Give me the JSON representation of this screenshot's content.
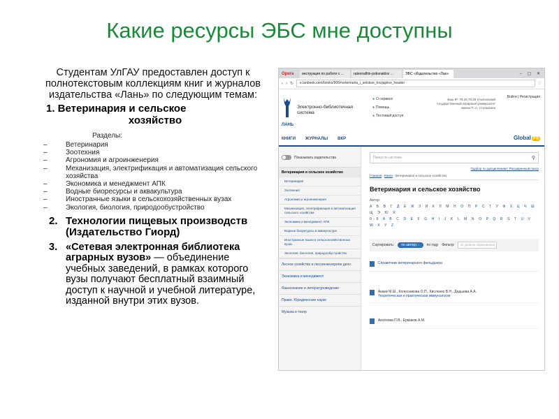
{
  "slide": {
    "title": "Какие ресурсы ЭБС мне доступны",
    "intro": "Студентам УлГАУ предоставлен доступ к полнотекстовым коллекциям книг и журналов издательства «Лань» по следующим темам:",
    "item1": {
      "line1": "1. Ветеринария и сельское",
      "line2": "хозяйство"
    },
    "sections_label": "Разделы:",
    "sections": [
      "Ветеринария",
      "Зоотехния",
      "Агрономия и агроинженерия",
      "Механизация, электрификация и автоматизация сельского хозяйства",
      "Экономика и менеджмент АПК",
      "Водные биоресурсы и аквакультура",
      "Иностранные языки в сельскохозяйственных вузах",
      "Экология, биология, природообустройство"
    ],
    "item2": {
      "lead": "2.",
      "body": "Технологии пищевых производств (Издательство Гиорд)"
    },
    "item3": {
      "lead": "3.",
      "body_bold": "«Сетевая электронная библиотека аграрных вузов»",
      "body_rest": " — объединение учебных заведений, в рамках которого вузы получают бесплатный взаимный доступ к научной и учебной литературе, изданной внутри этих вузов."
    }
  },
  "screenshot": {
    "browser": {
      "opera_label": "Opera",
      "tabs": [
        "инструкция по работе с ...",
        "rateonalltin-pobsnaklov ...",
        "ЭБС «Издательство «Лан»"
      ],
      "window_controls": "– ▢ ✕",
      "url": "e.lanbook.com/books/906#veterinaria_i_selskoe_hozjajstvo_header"
    },
    "site": {
      "logo_word": "ЛАНЬ",
      "name": "Электронно-библиотечная система",
      "topnav": [
        "О сервисе",
        "Помощь",
        "Тестовый доступ"
      ],
      "ip_info": "Ваш IP: 79.25.78.28 Ульяновский государственный аграрный университет имени П. А. Столыпина",
      "user_menu": "Войти | Регистрация",
      "mainnav": [
        "КНИГИ",
        "ЖУРНАЛЫ",
        "ВКР"
      ],
      "global_label": "Global",
      "global_badge": "F5"
    },
    "sidebar": {
      "toggle_label": "Показывать издательства",
      "category_head": "Ветеринария и сельское хозяйство",
      "subcategories": [
        "Ветеринария",
        "Зоотехния",
        "Агрономия и агроинженерия",
        "Механизация, электрификация и автоматизация сельского хозяйства",
        "Экономика и менеджмент АПК",
        "Водные биоресурсы и аквакультура",
        "Иностранные языки в сельскохозяйственных вузах",
        "Экология, биология, природообустройство"
      ],
      "categories": [
        "Лесное хозяйство и лесоинженерное дело",
        "Экономика и менеджмент",
        "Языкознание и литературоведение",
        "Право. Юридические науки",
        "Музыка и театр"
      ]
    },
    "main": {
      "search_placeholder": "Поиск по системе",
      "sublinks": "Подбор по дисциплинам | Расширенный поиск",
      "crumbs_home": "Главная",
      "crumbs_books": "Книги",
      "crumbs_current": "Ветеринария и сельское хозяйство",
      "heading": "Ветеринария и сельское хозяйство",
      "author_label": "Автор:",
      "alphabet_ru": "А Б В Г Д Е Ж З И К Л М Н О П Р С Т У Ф Х Ц Ч Ш Щ Э Ю Я",
      "alphabet_lat": "0-9 A B C D E F G H I J K L M N O P Q R S T U V W X Y Z",
      "sort_label": "Сортировать:",
      "sort_pill": "по автору ↓",
      "sort_year": "по году",
      "filter_label": "Фильтр:",
      "filter_placeholder": "по уровню образования",
      "books": [
        {
          "author": "",
          "title": "Справочник ветеринарного фельдшера"
        },
        {
          "author": "Акаев М.Ш., Колесникова О.П., Кисленко В.Н., Дадыева А.А.",
          "title": "Теоретическая и практическая иммунология"
        },
        {
          "author": "Аксёнова П.В., Ермаков А.М.",
          "title": ""
        }
      ]
    }
  }
}
